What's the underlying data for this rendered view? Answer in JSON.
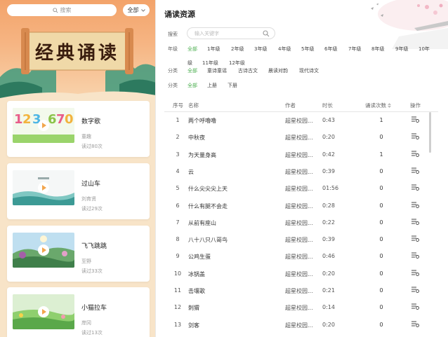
{
  "sidebar": {
    "search_placeholder": "搜索",
    "grade_select": "全部",
    "banner_title": "经典诵读",
    "cards": [
      {
        "title": "数字歌",
        "author": "童趣",
        "count": "读过80次",
        "thumb": "numbers"
      },
      {
        "title": "过山车",
        "author": "刘育贤",
        "count": "读过29次",
        "thumb": "wave"
      },
      {
        "title": "飞飞跳跳",
        "author": "至野",
        "count": "读过33次",
        "thumb": "landscape"
      },
      {
        "title": "小猫拉车",
        "author": "岸冈",
        "count": "读过13次",
        "thumb": "meadow"
      }
    ]
  },
  "main": {
    "title": "诵读资源",
    "search_label": "搜索",
    "search_placeholder": "输入关键字",
    "grade_label": "年级",
    "grade_options": [
      "全部",
      "1年级",
      "2年级",
      "3年级",
      "4年级",
      "5年级",
      "6年级",
      "7年级",
      "8年级",
      "9年级",
      "10年",
      "级",
      "11年级",
      "12年级"
    ],
    "category_label": "分类",
    "category_options": [
      "全部",
      "童诗童谣",
      "古诗古文",
      "晨读对韵",
      "现代诗文"
    ],
    "volume_label": "分类",
    "volume_options": [
      "全部",
      "上册",
      "下册"
    ],
    "table": {
      "headers": {
        "idx": "序号",
        "name": "名称",
        "author": "作者",
        "duration": "时长",
        "count": "诵读次数",
        "op": "操作"
      },
      "rows": [
        {
          "idx": "1",
          "name": "两个呼噜噜",
          "author": "超星校园...",
          "duration": "0:43",
          "count": "1"
        },
        {
          "idx": "2",
          "name": "中秋夜",
          "author": "超星校园...",
          "duration": "0:20",
          "count": "0"
        },
        {
          "idx": "3",
          "name": "为天量身高",
          "author": "超星校园...",
          "duration": "0:42",
          "count": "1"
        },
        {
          "idx": "4",
          "name": "云",
          "author": "超星校园...",
          "duration": "0:39",
          "count": "0"
        },
        {
          "idx": "5",
          "name": "什么尖尖尖上天",
          "author": "超星校园...",
          "duration": "01:56",
          "count": "0"
        },
        {
          "idx": "6",
          "name": "什么有腿不会走",
          "author": "超星校园...",
          "duration": "0:28",
          "count": "0"
        },
        {
          "idx": "7",
          "name": "从前有座山",
          "author": "超星校园...",
          "duration": "0:22",
          "count": "0"
        },
        {
          "idx": "8",
          "name": "八十八只八哥鸟",
          "author": "超星校园...",
          "duration": "0:39",
          "count": "0"
        },
        {
          "idx": "9",
          "name": "公鸡生蛋",
          "author": "超星校园...",
          "duration": "0:46",
          "count": "0"
        },
        {
          "idx": "10",
          "name": "冰锅盖",
          "author": "超星校园...",
          "duration": "0:20",
          "count": "0"
        },
        {
          "idx": "11",
          "name": "击壤歌",
          "author": "超星校园...",
          "duration": "0:21",
          "count": "0"
        },
        {
          "idx": "12",
          "name": "刺猬",
          "author": "超星校园...",
          "duration": "0:14",
          "count": "0"
        },
        {
          "idx": "13",
          "name": "剑客",
          "author": "超星校园...",
          "duration": "0:20",
          "count": "0"
        }
      ]
    }
  },
  "colors": {
    "accent_green": "#4caf50",
    "banner_orange": "#f3a36a",
    "sidebar_bg": "#f8e4c8"
  }
}
